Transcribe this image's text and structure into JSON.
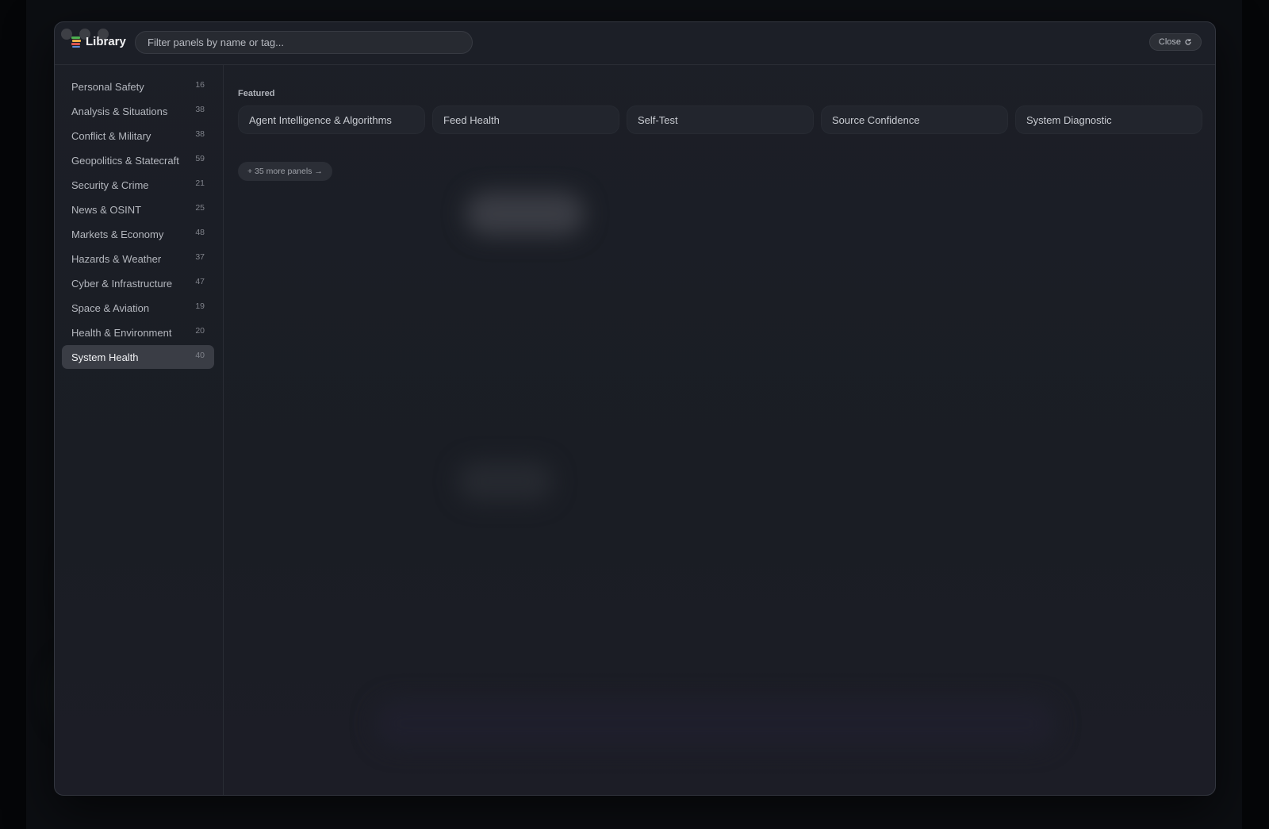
{
  "app": {
    "title": "Library"
  },
  "search": {
    "placeholder": "Filter panels by name or tag..."
  },
  "close_button": {
    "label": "Close"
  },
  "categories": [
    {
      "name": "Personal Safety",
      "count": "16"
    },
    {
      "name": "Analysis & Situations",
      "count": "38"
    },
    {
      "name": "Conflict & Military",
      "count": "38"
    },
    {
      "name": "Geopolitics & Statecraft",
      "count": "59"
    },
    {
      "name": "Security & Crime",
      "count": "21"
    },
    {
      "name": "News & OSINT",
      "count": "25"
    },
    {
      "name": "Markets & Economy",
      "count": "48"
    },
    {
      "name": "Hazards & Weather",
      "count": "37"
    },
    {
      "name": "Cyber & Infrastructure",
      "count": "47"
    },
    {
      "name": "Space & Aviation",
      "count": "19"
    },
    {
      "name": "Health & Environment",
      "count": "20"
    },
    {
      "name": "System Health",
      "count": "40",
      "active": true
    }
  ],
  "featured": {
    "title": "Featured",
    "panels": [
      "Agent Intelligence & Algorithms",
      "Feed Health",
      "Self-Test",
      "Source Confidence",
      "System Diagnostic"
    ],
    "more_label": "+ 35 more panels →"
  },
  "colors": {
    "accent": "#3a3d45",
    "window_bg": "#1a1d24",
    "text": "#b4b7be"
  },
  "icons": {
    "brand": "books-icon",
    "close": "refresh-icon"
  }
}
